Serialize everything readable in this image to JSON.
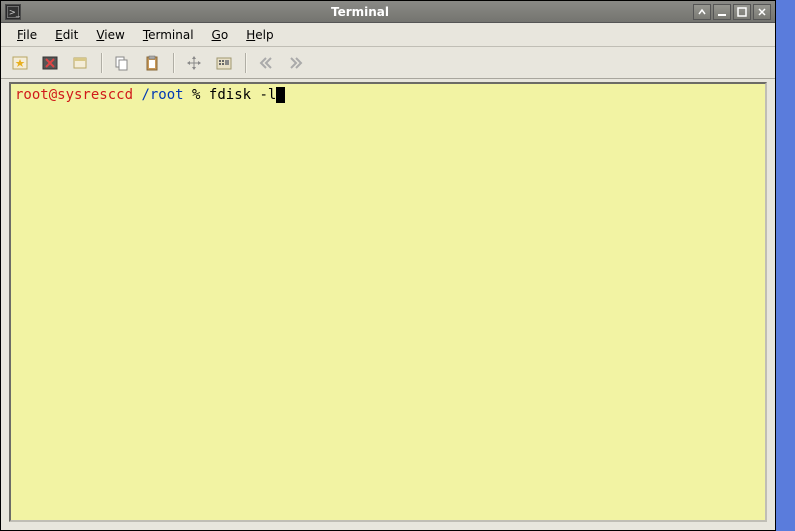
{
  "titlebar": {
    "title": "Terminal"
  },
  "menubar": {
    "file": "File",
    "edit": "Edit",
    "view": "View",
    "terminal": "Terminal",
    "go": "Go",
    "help": "Help"
  },
  "terminal": {
    "prompt_user": "root@sysresccd",
    "prompt_path": "/root",
    "prompt_symbol": " % ",
    "command": "fdisk -l"
  }
}
